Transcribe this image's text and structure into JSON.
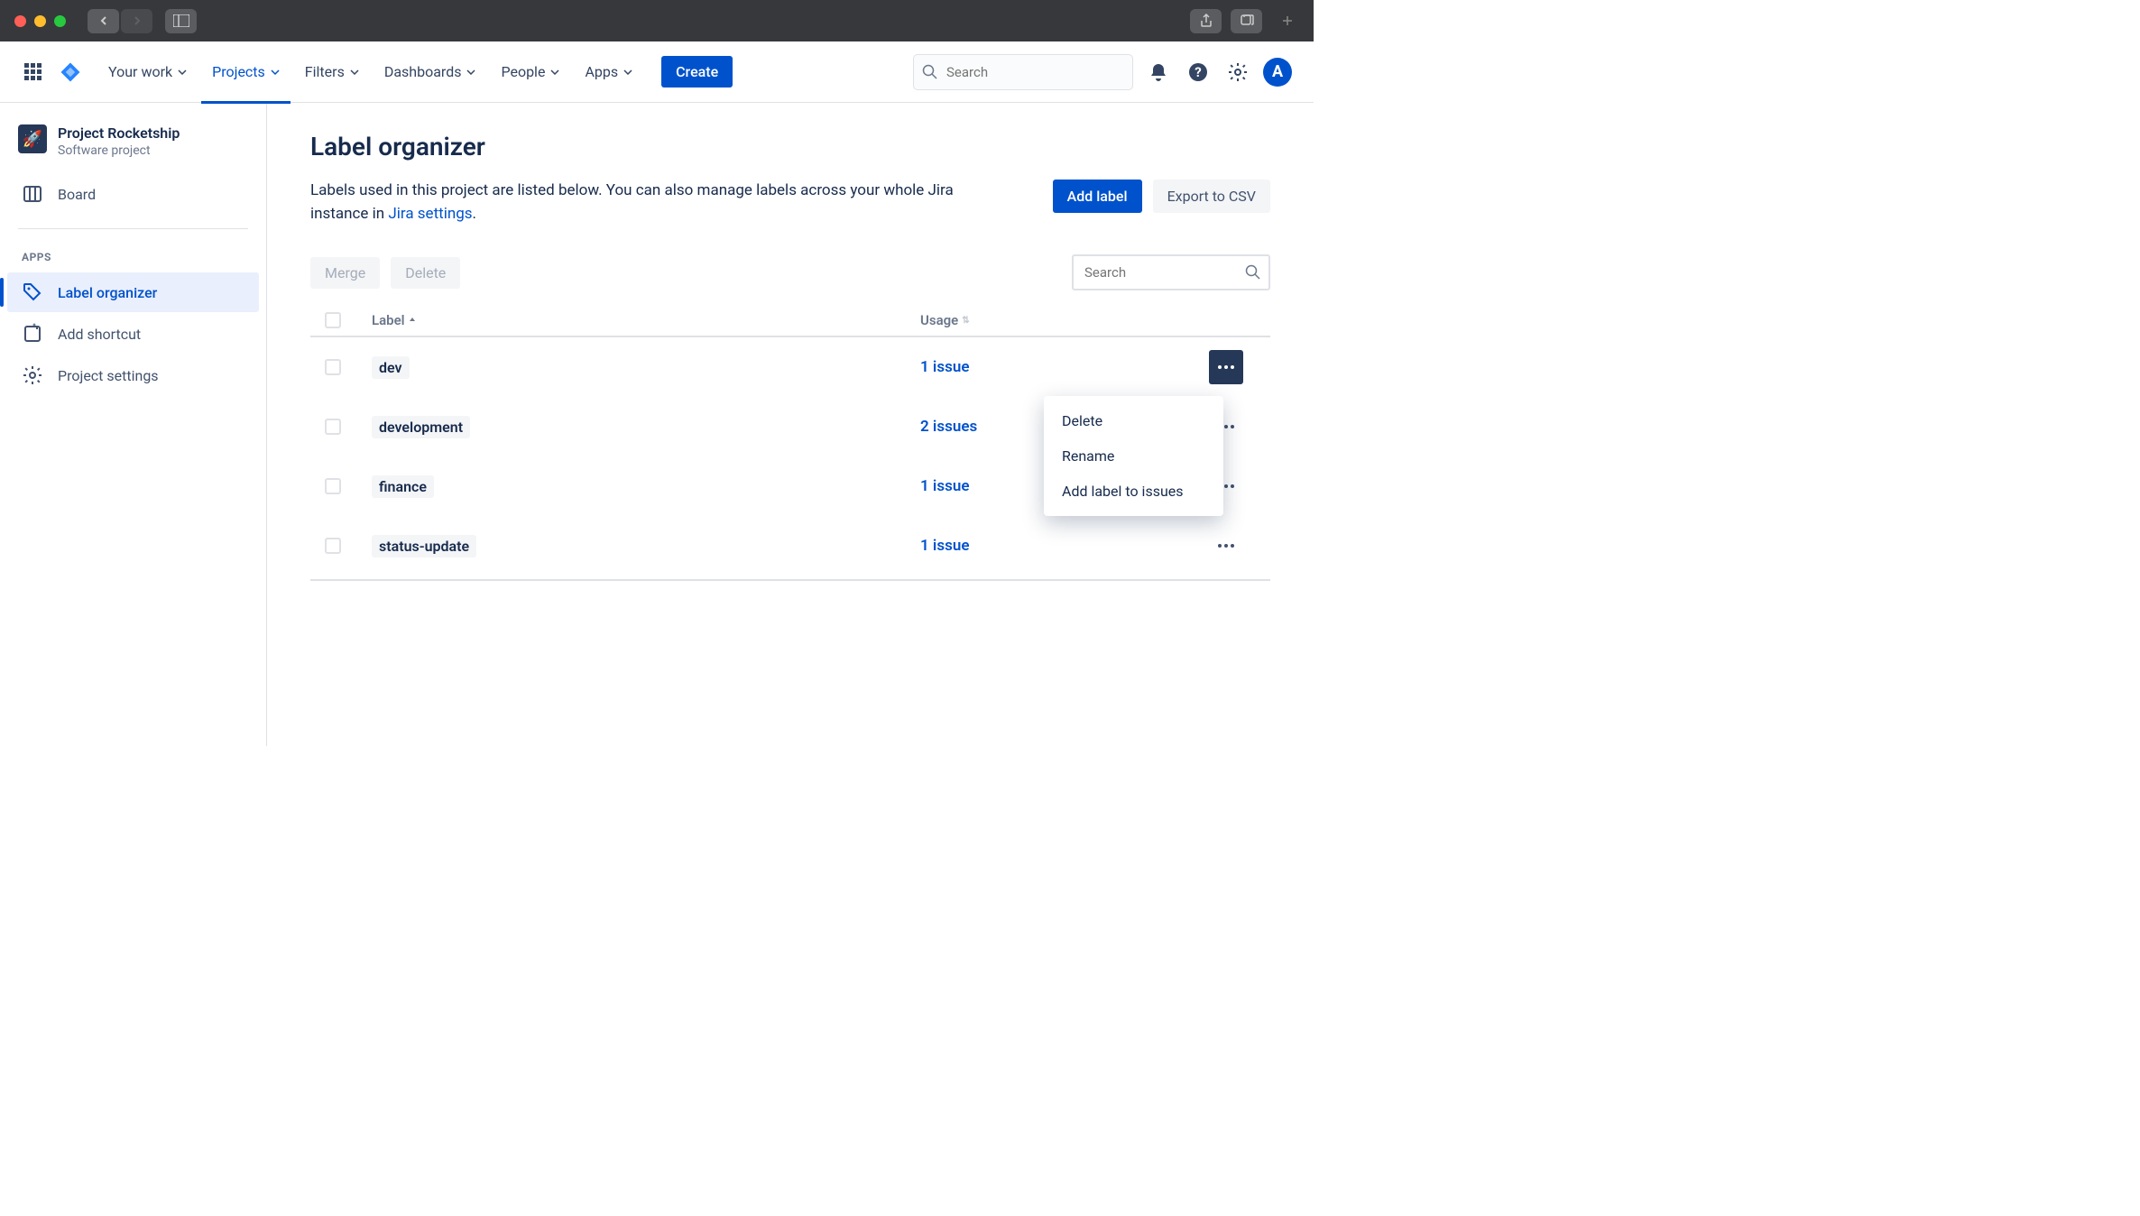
{
  "topnav": {
    "items": [
      "Your work",
      "Projects",
      "Filters",
      "Dashboards",
      "People",
      "Apps"
    ],
    "create": "Create",
    "search_placeholder": "Search",
    "avatar_letter": "A"
  },
  "sidebar": {
    "project_name": "Project Rocketship",
    "project_type": "Software project",
    "board": "Board",
    "section_apps": "APPS",
    "label_organizer": "Label organizer",
    "add_shortcut": "Add shortcut",
    "project_settings": "Project settings"
  },
  "main": {
    "title": "Label organizer",
    "desc_1": "Labels used in this project are listed below. You can also manage labels across your whole Jira instance in ",
    "desc_link": "Jira settings",
    "desc_2": ".",
    "add_label": "Add label",
    "export_csv": "Export to CSV",
    "merge": "Merge",
    "delete": "Delete",
    "table_search_placeholder": "Search",
    "col_label": "Label",
    "col_usage": "Usage",
    "rows": [
      {
        "label": "dev",
        "usage": "1 issue"
      },
      {
        "label": "development",
        "usage": "2 issues"
      },
      {
        "label": "finance",
        "usage": "1 issue"
      },
      {
        "label": "status-update",
        "usage": "1 issue"
      }
    ]
  },
  "dropdown": {
    "delete": "Delete",
    "rename": "Rename",
    "add_to_issues": "Add label to issues"
  }
}
